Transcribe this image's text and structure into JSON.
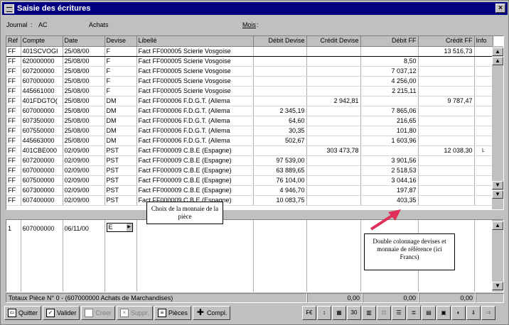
{
  "window": {
    "title": "Saisie des écritures",
    "close": "×"
  },
  "header": {
    "journal_label": "Journal",
    "journal_code": "AC",
    "journal_name": "Achats",
    "mois_label": "Mois"
  },
  "columns": [
    "Réf",
    "Compte",
    "Date",
    "Devise",
    "Libellé",
    "Débit Devise",
    "Crédit Devise",
    "Débit FF",
    "Crédit FF",
    "Info"
  ],
  "rows": [
    [
      "FF",
      "401SCVOGI",
      "25/08/00",
      "F",
      "Fact FF000005 Scierie Vosgoise",
      "",
      "",
      "",
      "13 516,73",
      ""
    ],
    [
      "FF",
      "620000000",
      "25/08/00",
      "F",
      "Fact FF000005 Scierie Vosgoise",
      "",
      "",
      "8,50",
      "",
      ""
    ],
    [
      "FF",
      "607200000",
      "25/08/00",
      "F",
      "Fact FF000005 Scierie Vosgoise",
      "",
      "",
      "7 037,12",
      "",
      ""
    ],
    [
      "FF",
      "607000000",
      "25/08/00",
      "F",
      "Fact FF000005 Scierie Vosgoise",
      "",
      "",
      "4 256,00",
      "",
      ""
    ],
    [
      "FF",
      "445661000",
      "25/08/00",
      "F",
      "Fact FF000005 Scierie Vosgoise",
      "",
      "",
      "2 215,11",
      "",
      ""
    ],
    [
      "FF",
      "401FDGTO(",
      "25/08/00",
      "DM",
      "Fact FF000006 F.D.G.T. (Allema",
      "",
      "2 942,81",
      "",
      "9 787,47",
      ""
    ],
    [
      "FF",
      "607000000",
      "25/08/00",
      "DM",
      "Fact FF000006 F.D.G.T. (Allema",
      "2 345,19",
      "",
      "7 865,06",
      "",
      ""
    ],
    [
      "FF",
      "607350000",
      "25/08/00",
      "DM",
      "Fact FF000006 F.D.G.T. (Allema",
      "64,60",
      "",
      "216,65",
      "",
      ""
    ],
    [
      "FF",
      "607550000",
      "25/08/00",
      "DM",
      "Fact FF000006 F.D.G.T. (Allema",
      "30,35",
      "",
      "101,80",
      "",
      ""
    ],
    [
      "FF",
      "445663000",
      "25/08/00",
      "DM",
      "Fact FF000006 F.D.G.T. (Allema",
      "502,67",
      "",
      "1 603,96",
      "",
      ""
    ],
    [
      "FF",
      "401CBE000",
      "02/09/00",
      "PST",
      "Fact FF000009 C.B.E (Espagne)",
      "",
      "303 473,78",
      "",
      "12 038,30",
      "L"
    ],
    [
      "FF",
      "607200000",
      "02/09/00",
      "PST",
      "Fact FF000009 C.B.E (Espagne)",
      "97 539,00",
      "",
      "3 901,56",
      "",
      ""
    ],
    [
      "FF",
      "607000000",
      "02/09/00",
      "PST",
      "Fact FF000009 C.B.E (Espagne)",
      "63 889,65",
      "",
      "2 518,53",
      "",
      ""
    ],
    [
      "FF",
      "607500000",
      "02/09/00",
      "PST",
      "Fact FF000009 C.B.E (Espagne)",
      "76 104,00",
      "",
      "3 044,16",
      "",
      ""
    ],
    [
      "FF",
      "607300000",
      "02/09/00",
      "PST",
      "Fact FF000009 C.B.E (Espagne)",
      "4 946,70",
      "",
      "197,87",
      "",
      ""
    ],
    [
      "FF",
      "607400000",
      "02/09/00",
      "PST",
      "Fact FF000009 C.B.E (Espagne)",
      "10 083,75",
      "",
      "403,35",
      "",
      ""
    ]
  ],
  "entry": {
    "ref": "1",
    "compte": "607000000",
    "date": "06/11/00",
    "devise": "E"
  },
  "callouts": {
    "monnaie": "Choix de la monnaie de la pièce",
    "colonnage": "Double colonnage devises et monnaie de référence (ici Francs)"
  },
  "totals": {
    "label": "Totaux Pièce N° 0 - (607000000 Achats de Marchandises)",
    "debit_devise": "0,00",
    "debit_ff": "0,00",
    "credit_ff": "0,00"
  },
  "toolbar": {
    "quit": "Quitter",
    "validate": "Valider",
    "create": "Créer",
    "delete": "Suppr.",
    "pieces": "Pièces",
    "compl": "Compl."
  },
  "accent": "#000080",
  "arrow_color": "#e0305a"
}
